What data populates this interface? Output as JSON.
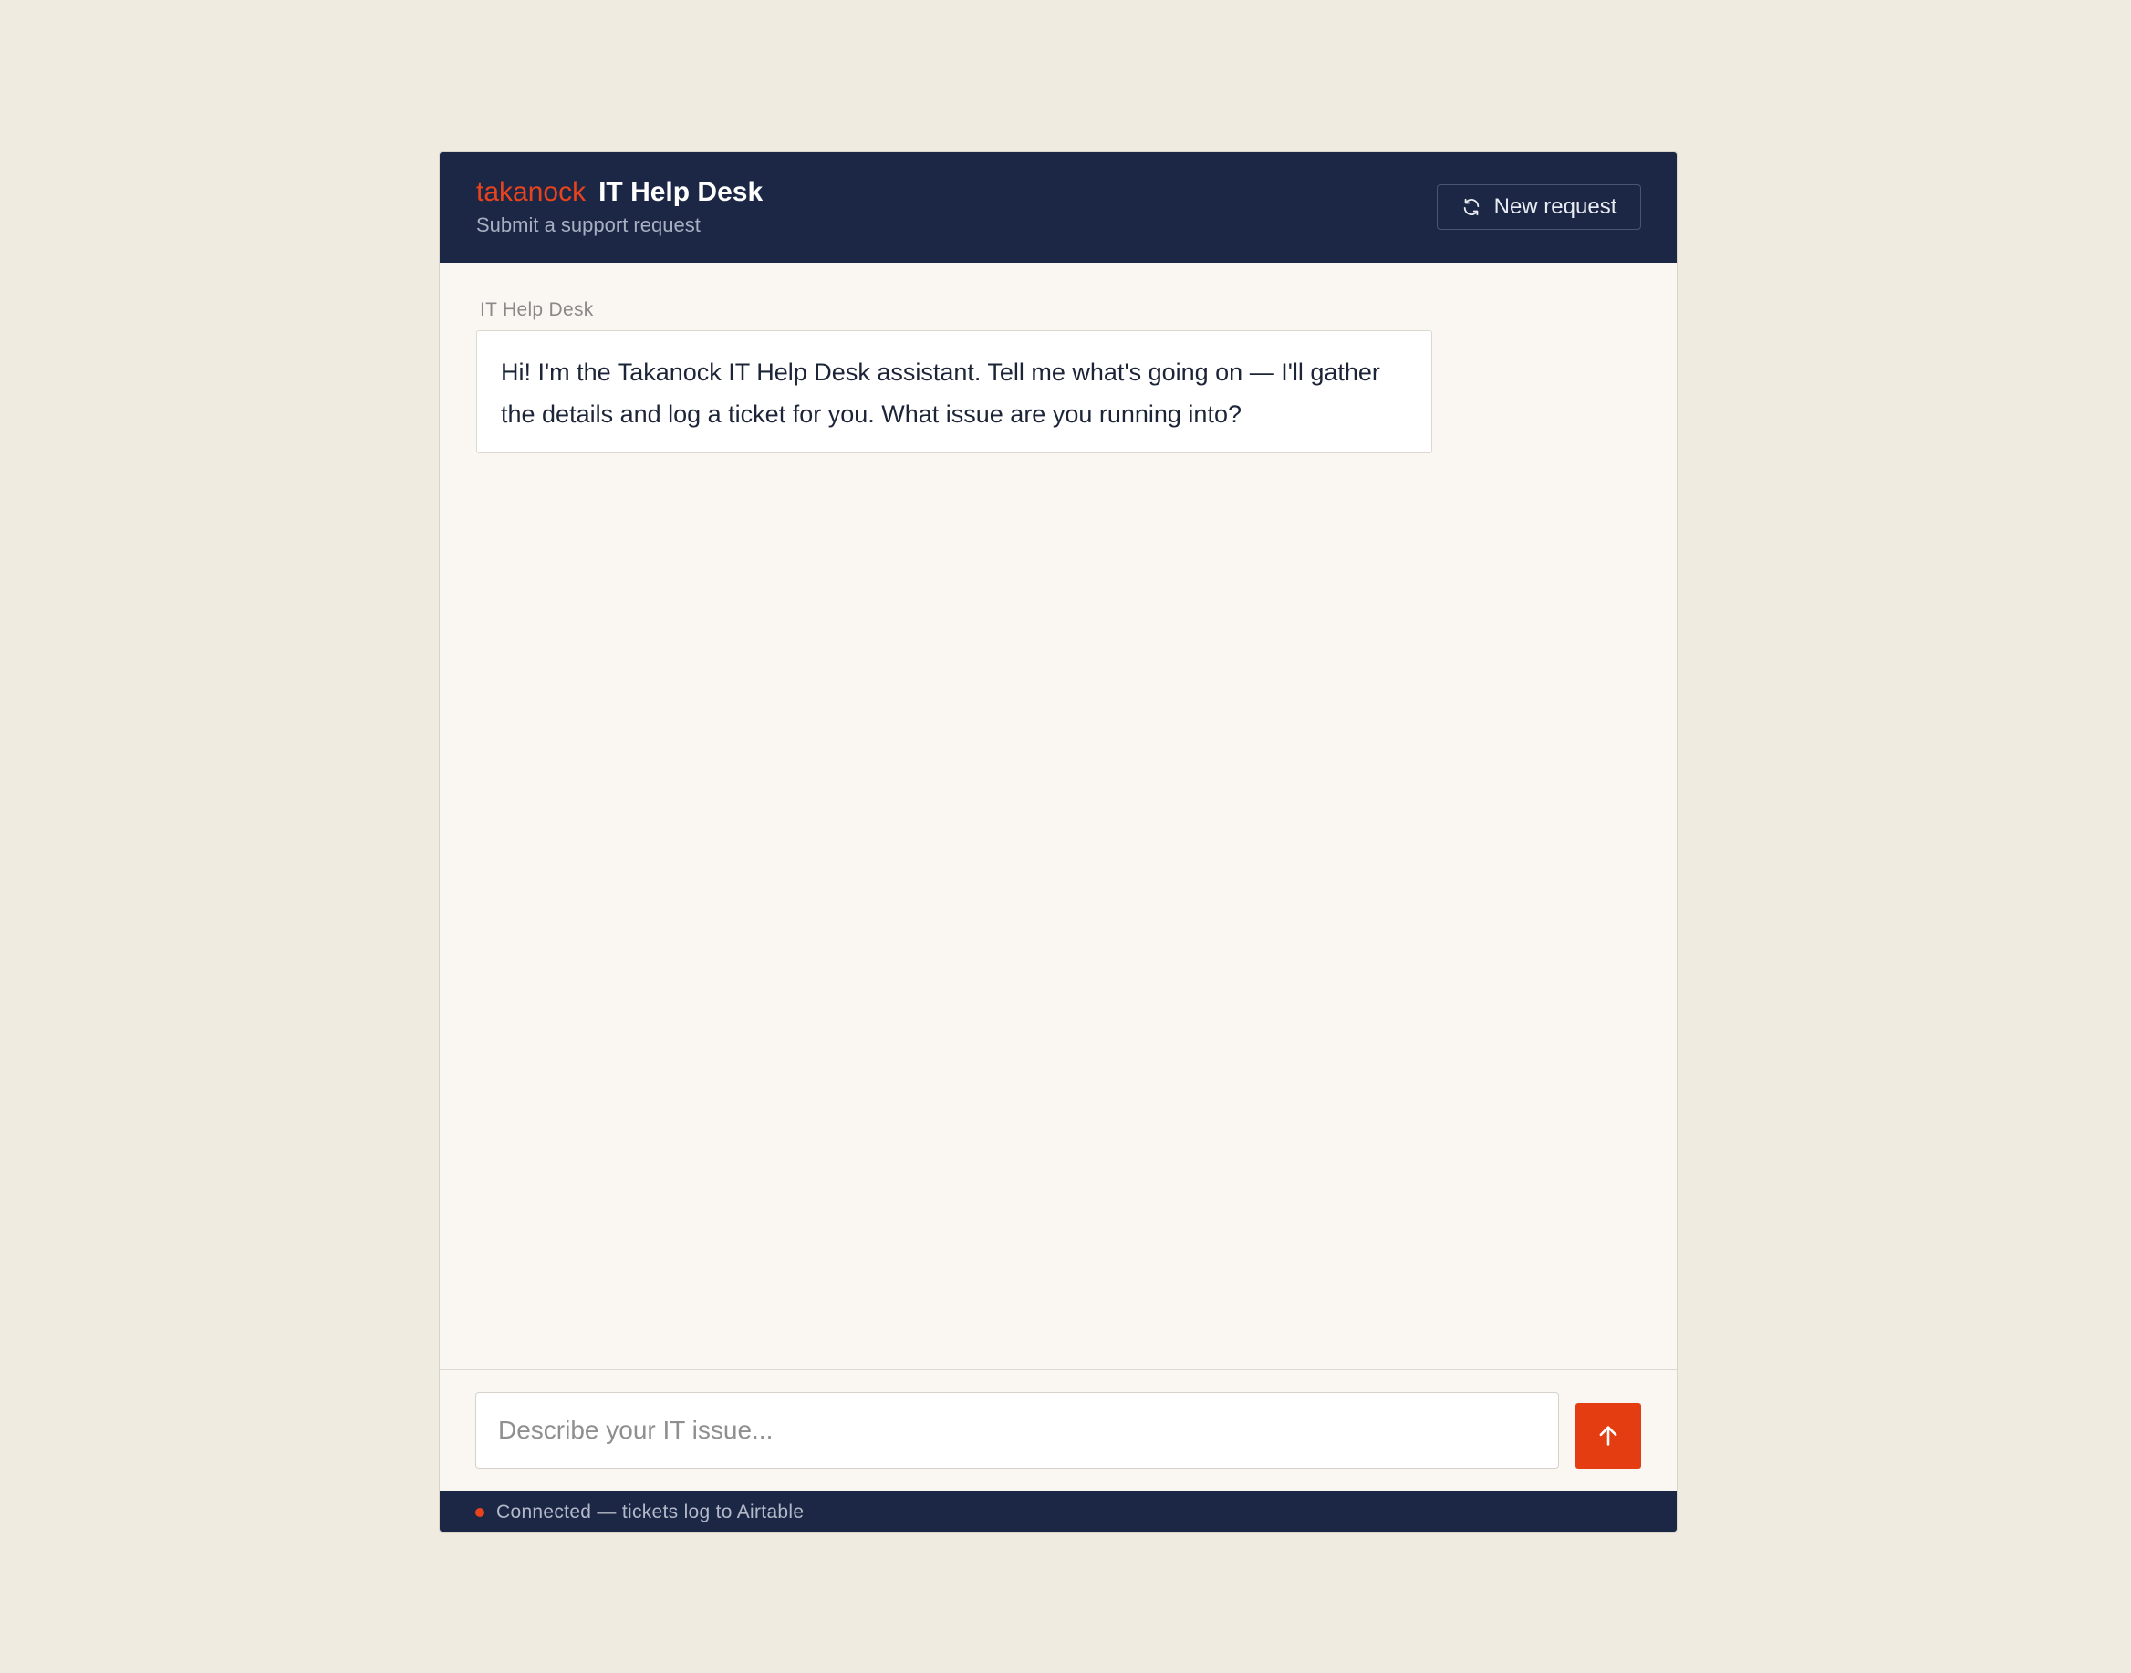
{
  "header": {
    "brand": "takanock",
    "title": "IT Help Desk",
    "subtitle": "Submit a support request",
    "new_request_label": "New request",
    "new_request_icon": "refresh-icon"
  },
  "chat": {
    "messages": [
      {
        "sender": "IT Help Desk",
        "text": "Hi! I'm the Takanock IT Help Desk assistant. Tell me what's going on — I'll gather the details and log a ticket for you. What issue are you running into?"
      }
    ]
  },
  "composer": {
    "placeholder": "Describe your IT issue...",
    "value": "",
    "send_icon": "arrow-up-icon"
  },
  "status": {
    "text": "Connected — tickets log to Airtable",
    "indicator_color": "#e8431d"
  },
  "colors": {
    "accent": "#e43d12",
    "header_bg": "#1b2745",
    "page_bg": "#f0ebe1"
  }
}
